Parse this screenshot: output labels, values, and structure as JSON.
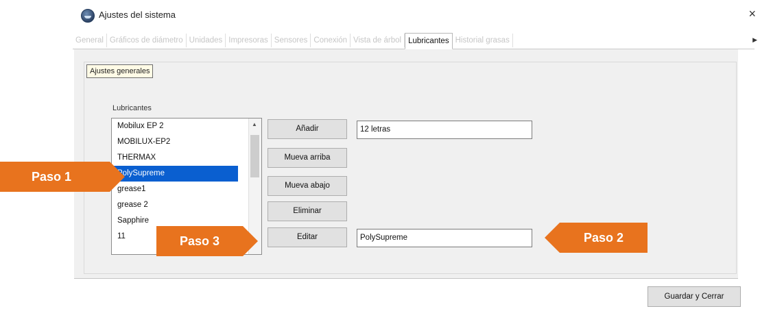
{
  "window": {
    "title": "Ajustes del sistema",
    "close_label": "×"
  },
  "tabs": [
    {
      "label": "General"
    },
    {
      "label": "Gráficos de diámetro"
    },
    {
      "label": "Unidades"
    },
    {
      "label": "Impresoras"
    },
    {
      "label": "Sensores"
    },
    {
      "label": "Conexión"
    },
    {
      "label": "Vista de árbol"
    },
    {
      "label": "Lubricantes"
    },
    {
      "label": "Historial grasas"
    }
  ],
  "active_tab": "Lubricantes",
  "panel": {
    "ajustes_button": "Ajustes generales",
    "group_label": "Lubricantes",
    "lubricants": [
      "Mobilux EP 2",
      "MOBILUX-EP2",
      "THERMAX",
      "PolySupreme",
      "grease1",
      "grease 2",
      "Sapphire",
      "11"
    ],
    "selected_index": 3,
    "buttons": {
      "add": "Añadir",
      "move_up": "Mueva arriba",
      "move_down": "Mueva abajo",
      "delete": "Eliminar",
      "edit": "Editar"
    },
    "name_field_value": "12 letras",
    "edit_field_value": "PolySupreme"
  },
  "footer": {
    "save_close": "Guardar y Cerrar"
  },
  "callouts": {
    "step1": "Paso 1",
    "step2": "Paso 2",
    "step3": "Paso 3",
    "color": "#e8731e"
  }
}
